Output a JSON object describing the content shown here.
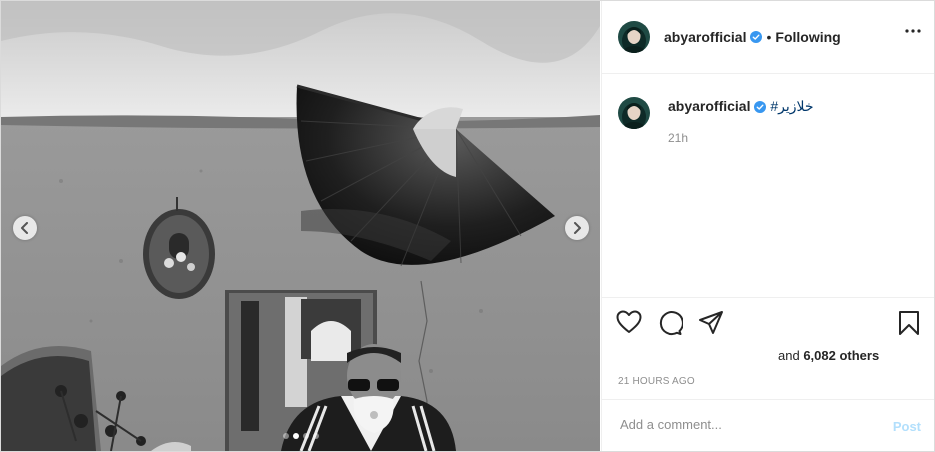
{
  "header": {
    "username": "abyarofficial",
    "separator": "•",
    "follow_status": "Following"
  },
  "caption": {
    "username": "abyarofficial",
    "text": "#خلازیر",
    "time": "21h"
  },
  "likes": {
    "prefix": "and ",
    "count": "6,082 others"
  },
  "timestamp": "21 HOURS AGO",
  "comment_box": {
    "placeholder": "Add a comment...",
    "post_label": "Post"
  },
  "carousel": {
    "slide_count": 4,
    "active_slide": 2
  },
  "colors": {
    "verified_badge": "#3897f0",
    "hashtag": "#00376b",
    "post_disabled": "#b2dffc"
  }
}
